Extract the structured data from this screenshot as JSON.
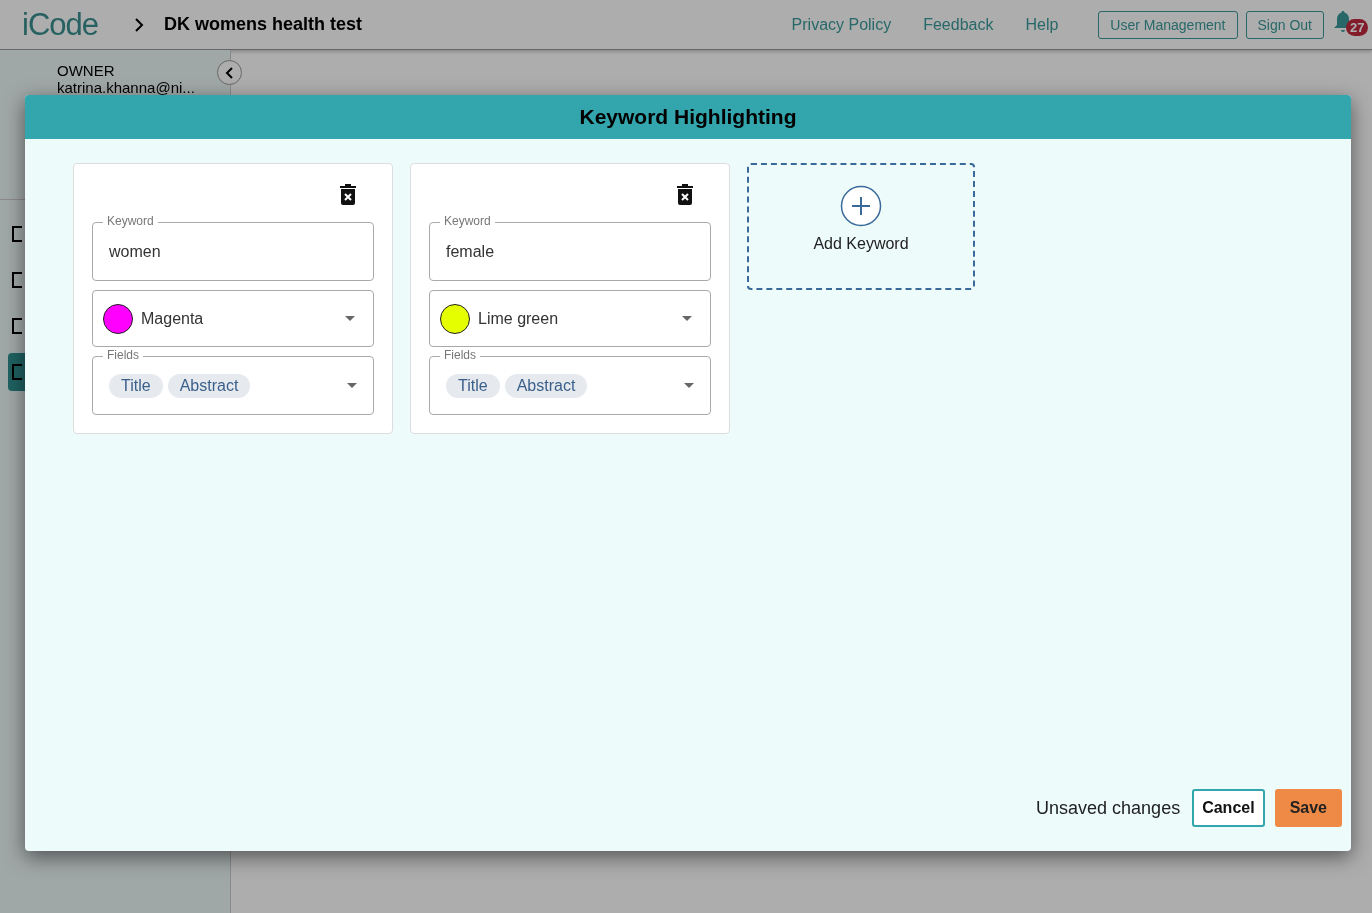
{
  "header": {
    "logo": "iCode",
    "project_title": "DK womens health test",
    "links": [
      "Privacy Policy",
      "Feedback",
      "Help"
    ],
    "buttons": [
      "User Management",
      "Sign Out"
    ],
    "notification_count": "27"
  },
  "sidebar": {
    "role": "OWNER",
    "email": "katrina.khanna@ni...",
    "nav_items": [
      {
        "selected": false
      },
      {
        "selected": false
      },
      {
        "selected": false
      },
      {
        "selected": true
      }
    ]
  },
  "dialog": {
    "title": "Keyword Highlighting",
    "keywords": [
      {
        "keyword_label": "Keyword",
        "keyword": "women",
        "color_name": "Magenta",
        "color": "#ff00ff",
        "fields_label": "Fields",
        "fields": [
          "Title",
          "Abstract"
        ]
      },
      {
        "keyword_label": "Keyword",
        "keyword": "female",
        "color_name": "Lime green",
        "color": "#e5ff00",
        "fields_label": "Fields",
        "fields": [
          "Title",
          "Abstract"
        ]
      }
    ],
    "add_label": "Add Keyword",
    "status": "Unsaved changes",
    "cancel": "Cancel",
    "save": "Save"
  }
}
